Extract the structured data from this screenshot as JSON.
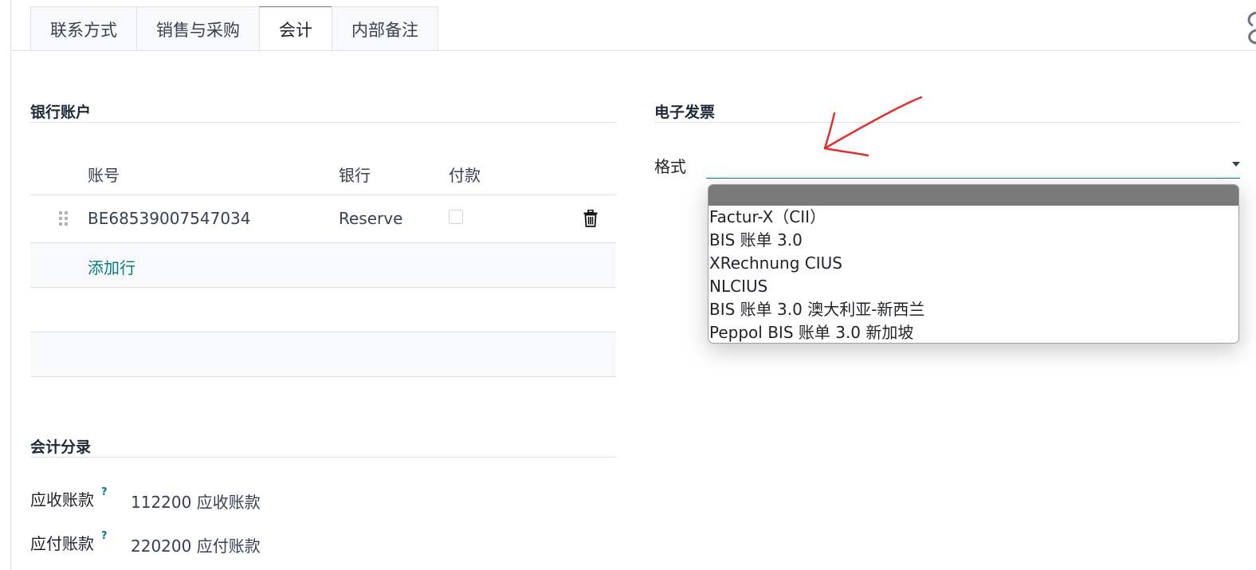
{
  "tabs": [
    {
      "label": "联系方式",
      "active": false
    },
    {
      "label": "销售与采购",
      "active": false
    },
    {
      "label": "会计",
      "active": true
    },
    {
      "label": "内部备注",
      "active": false
    }
  ],
  "bank_accounts": {
    "title": "银行账户",
    "columns": {
      "account_number": "账号",
      "bank": "银行",
      "payment": "付款"
    },
    "rows": [
      {
        "account_number": "BE68539007547034",
        "bank": "Reserve",
        "payment": false
      }
    ],
    "add_line_label": "添加行"
  },
  "accounting_entries": {
    "title": "会计分录",
    "fields": [
      {
        "label": "应收账款",
        "help": "?",
        "value": "112200 应收账款"
      },
      {
        "label": "应付账款",
        "help": "?",
        "value": "220200 应付账款"
      }
    ]
  },
  "einvoicing": {
    "title": "电子发票",
    "format_label": "格式",
    "format_value": "",
    "options": [
      "",
      "Factur-X（CII）",
      "BIS 账单 3.0",
      "XRechnung CIUS",
      "NLCIUS",
      "BIS 账单 3.0 澳大利亚-新西兰",
      "Peppol BIS 账单 3.0 新加坡"
    ]
  },
  "colors": {
    "accent": "#017e84",
    "annotation": "#e0302c",
    "selected_option": "#7a7a7a",
    "tab_active_top": "#71639e"
  },
  "icons": {
    "drag_handle": "drag-handle-icon",
    "delete": "trash-icon",
    "dropdown": "caret-down-icon",
    "annotation": "arrow-annotation"
  }
}
